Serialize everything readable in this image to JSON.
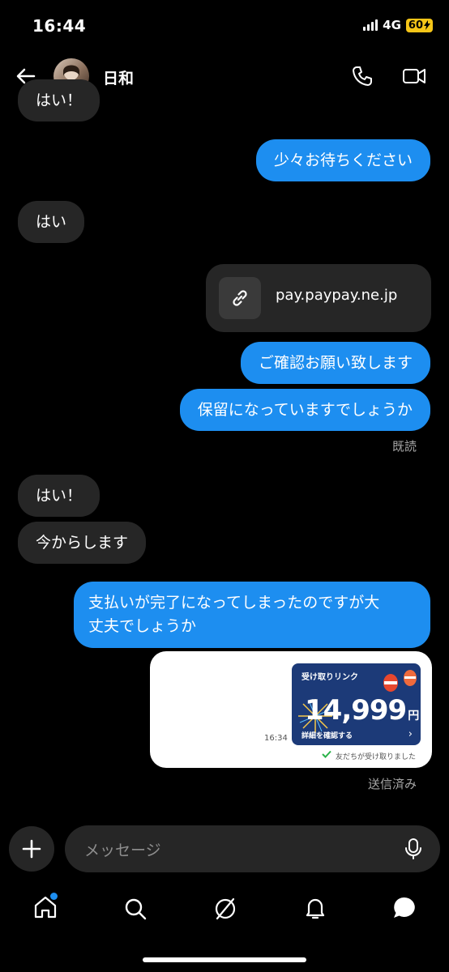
{
  "status_bar": {
    "time": "16:44",
    "network": "4G",
    "battery": "60"
  },
  "header": {
    "contact_name": "日和"
  },
  "messages": {
    "partial_top": "はい！",
    "m1": "少々お待ちください",
    "m2": "はい",
    "link_domain": "pay.paypay.ne.jp",
    "m3": "ご確認お願い致します",
    "m4": "保留になっていますでしょうか",
    "read_receipt": "既読",
    "m5": "はい！",
    "m6": "今からします",
    "m7_line1": "支払いが完了になってしまったのですが大",
    "m7_line2": "丈夫でしょうか",
    "sent_status": "送信済み"
  },
  "paypay_card": {
    "header": "受け取りリンク",
    "amount": "14,999",
    "currency": "円",
    "details_link": "詳細を確認する",
    "time": "16:34",
    "received_text": "友だちが受け取りました"
  },
  "composer": {
    "placeholder": "メッセージ"
  },
  "colors": {
    "outgoing": "#1d8ef0",
    "incoming": "#262626",
    "background": "#000000",
    "badge": "#1d8ef0"
  },
  "icons": [
    "back-arrow-icon",
    "phone-icon",
    "video-icon",
    "link-icon",
    "plus-icon",
    "mic-icon",
    "home-icon",
    "search-icon",
    "explore-icon",
    "bell-icon",
    "messages-icon"
  ]
}
